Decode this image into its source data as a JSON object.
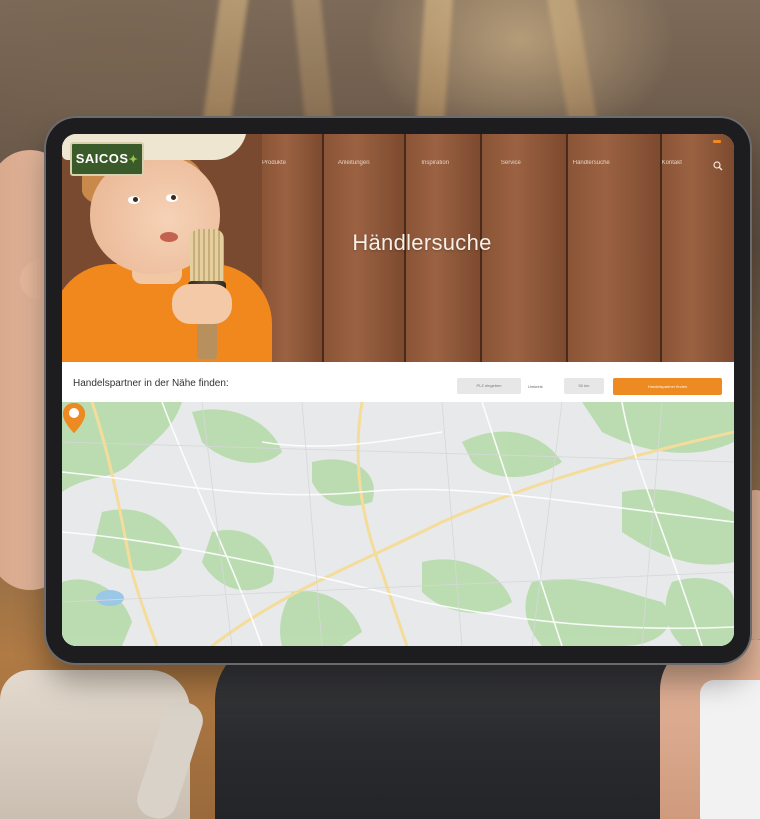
{
  "page": {
    "hero_title": "Händlersuche",
    "logo_text": "SAICOS",
    "nav": [
      "Produkte",
      "Anleitungen",
      "Inspiration",
      "Service",
      "Händlersuche",
      "Kontakt"
    ]
  },
  "search": {
    "title": "Handelspartner in der Nähe finden:",
    "zip_placeholder": "PLZ eingeben",
    "radius_label": "Umkreis",
    "radius_value": "50 km",
    "button_label": "Handelspartner finden"
  },
  "map": {
    "markers": [
      "partner-1",
      "partner-2",
      "partner-3"
    ]
  },
  "colors": {
    "accent": "#ee8a22",
    "wood": "#8a5436",
    "map_green": "#b9dcae",
    "map_water": "#9cc8e8"
  },
  "icons": [
    "search-icon",
    "map-pin-icon"
  ]
}
